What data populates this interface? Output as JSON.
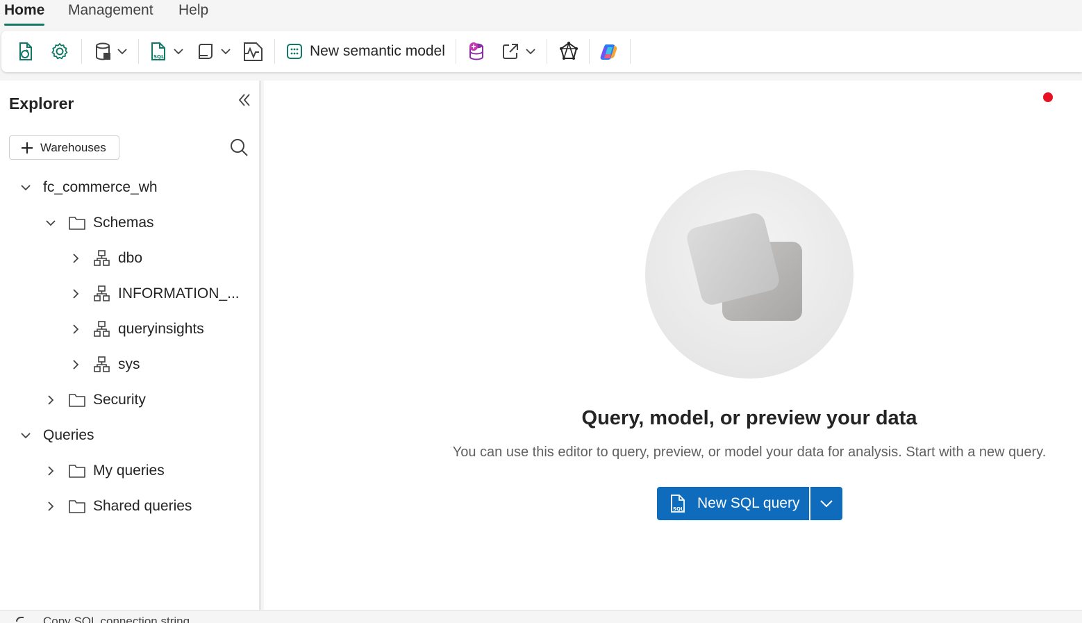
{
  "menu": {
    "tabs": [
      "Home",
      "Management",
      "Help"
    ],
    "active": "Home"
  },
  "ribbon": {
    "buttons": [
      {
        "name": "refresh-icon"
      },
      {
        "name": "settings-icon"
      },
      {
        "name": "get-data-icon"
      },
      {
        "name": "new-sql-query-icon"
      },
      {
        "name": "new-visual-query-icon"
      },
      {
        "name": "performance-icon"
      },
      {
        "name": "semantic-model-icon"
      },
      {
        "name": "database-add-icon"
      },
      {
        "name": "open-in-icon"
      },
      {
        "name": "graph-icon"
      },
      {
        "name": "copilot-icon"
      }
    ],
    "new_semantic_model_label": "New semantic model"
  },
  "explorer": {
    "title": "Explorer",
    "add_button_label": "Warehouses",
    "tree": {
      "warehouse": "fc_commerce_wh",
      "schemas": "Schemas",
      "schema_items": [
        "dbo",
        "INFORMATION_...",
        "queryinsights",
        "sys"
      ],
      "security": "Security",
      "queries": "Queries",
      "my_queries": "My queries",
      "shared_queries": "Shared queries"
    }
  },
  "main": {
    "title": "Query, model, or preview your data",
    "description": "You can use this editor to query, preview, or model your data for analysis. Start with a new query.",
    "primary_button_label": "New SQL query"
  },
  "statusbar": {
    "copy_label": "Copy SQL connection string"
  },
  "colors": {
    "accent_tab": "#117865",
    "primary_button": "#0f6cbd",
    "notification_dot": "#e81123"
  }
}
